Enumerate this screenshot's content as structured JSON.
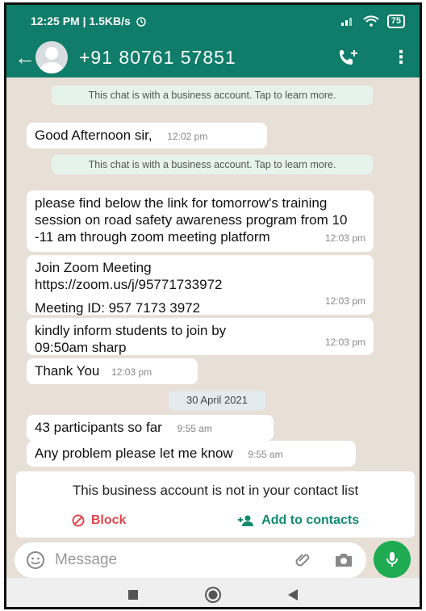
{
  "status_bar": {
    "time_speed": "12:25 PM | 1.5KB/s",
    "battery": "75"
  },
  "header": {
    "contact": "+91 80761 57851"
  },
  "messages": {
    "sys1": "This chat is with a business account. Tap to learn more.",
    "m1_text": "Good Afternoon sir,",
    "m1_time": "12:02 pm",
    "sys2": "This chat is with a business account. Tap to learn more.",
    "m2_text": "please find below the link for tomorrow's training session on road safety awareness program from 10 -11 am through zoom meeting platform",
    "m2_time": "12:03 pm",
    "m3_line1": "Join Zoom Meeting",
    "m3_line2": "https://zoom.us/j/95771733972",
    "m3_line3": "Meeting ID: 957 7173 3972",
    "m3_time": "12:03 pm",
    "m4_text": "kindly inform students to join by 09:50am sharp",
    "m4_time": "12:03 pm",
    "m5_text": "Thank You",
    "m5_time": "12:03 pm",
    "date": "30 April 2021",
    "m6_text": "43 participants so far",
    "m6_time": "9:55 am",
    "m7_text": "Any problem please let me know",
    "m7_time": "9:55 am"
  },
  "banner": {
    "note": "This business account is not in your contact list",
    "block_label": "Block",
    "add_label": "Add to contacts"
  },
  "input": {
    "placeholder": "Message"
  },
  "colors": {
    "header": "#0f7d69",
    "mic": "#1eab52",
    "block": "#e0474c",
    "add": "#0f8a6f"
  }
}
